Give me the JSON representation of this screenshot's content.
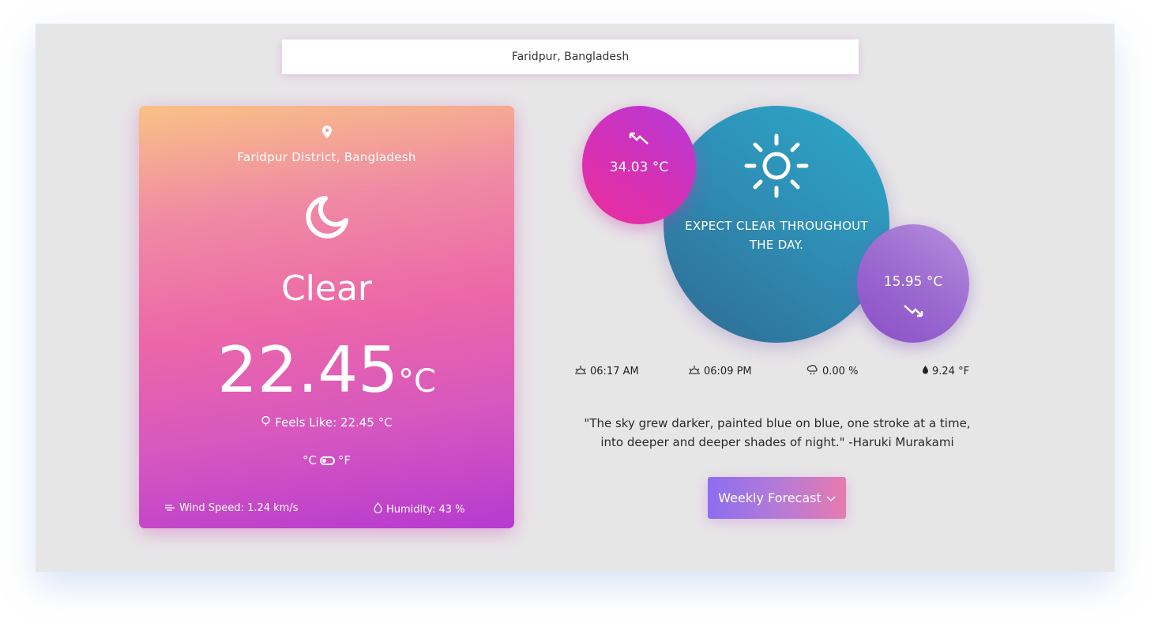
{
  "search": {
    "value": "Faridpur, Bangladesh"
  },
  "current": {
    "location": "Faridpur District, Bangladesh",
    "condition": "Clear",
    "temperature": "22.45",
    "temperature_unit": "°C",
    "feels_like": "Feels Like: 22.45 °C",
    "unit_toggle": {
      "celsius": "°C",
      "fahrenheit": "°F"
    },
    "wind_speed": "Wind Speed: 1.24 km/s",
    "humidity": "Humidity: 43 %",
    "icon": "moon-icon"
  },
  "forecast": {
    "summary": "EXPECT CLEAR THROUGHOUT THE DAY.",
    "high": "34.03 °C",
    "low": "15.95 °C",
    "icon": "sun-icon"
  },
  "stats": {
    "sunrise": "06:17 AM",
    "sunset": "06:09 PM",
    "precipitation": "0.00 %",
    "dew_point": "9.24 °F"
  },
  "quote": "\"The sky grew darker, painted blue on blue, one stroke at a time, into deeper and deeper shades of night.\" -Haruki Murakami",
  "weekly_button": "Weekly Forecast",
  "colors": {
    "background": "#e7e6e7",
    "card_top": "#f9c285",
    "card_bottom": "#b63ad0",
    "big_bubble": "#2ba8c8",
    "high_bubble": "#ec2e9c",
    "low_bubble": "#9c6ad0"
  }
}
